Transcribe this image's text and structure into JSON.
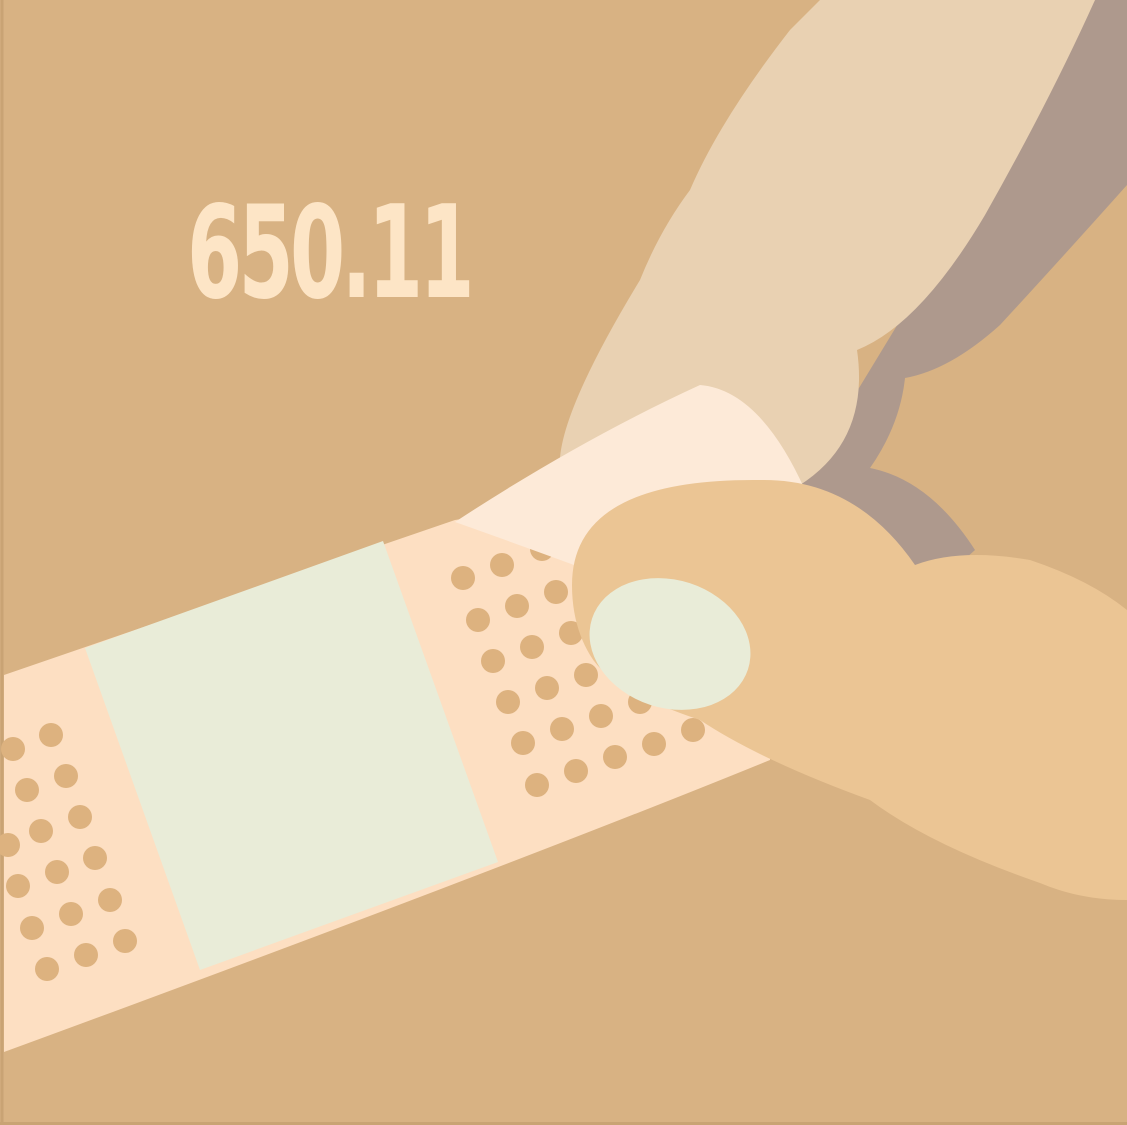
{
  "illustration": {
    "code_text": "650.11",
    "subject": "hand-applying-adhesive-bandage",
    "colors": {
      "background": "#D8B283",
      "frame_border": "#C9A374",
      "bandage_strip": "#FDDFC2",
      "bandage_pad": "#E9ECD8",
      "bandage_holes": "#DDB27F",
      "peeled_backing": "#FDEAD8",
      "sleeve": "#E9D1B2",
      "sleeve_shadow": "#AE998D",
      "hand": "#EBC594",
      "fingernail": "#E9ECD8",
      "code_text": "#FDE5C6"
    }
  }
}
